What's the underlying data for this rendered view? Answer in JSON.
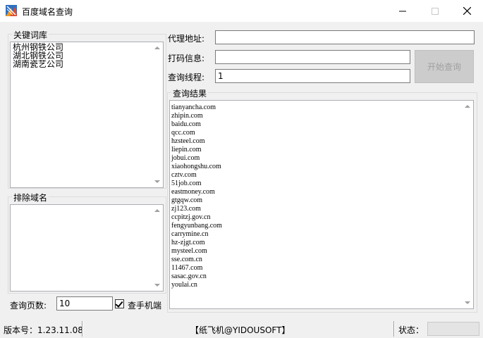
{
  "window": {
    "title": "百度域名查询",
    "minimize": "—",
    "maximize": "☐",
    "close": "✕"
  },
  "keywords": {
    "label": "关键词库",
    "items": [
      "杭州钢铁公司",
      "湖北钢铁公司",
      "湖南瓷艺公司"
    ]
  },
  "exclude": {
    "label": "排除域名",
    "items": []
  },
  "form": {
    "proxy_label": "代理地址:",
    "proxy_value": "",
    "captcha_label": "打码信息:",
    "captcha_value": "",
    "threads_label": "查询线程:",
    "threads_value": "1",
    "start_button": "开始查询",
    "pages_label": "查询页数:",
    "pages_value": "10",
    "mobile_label": "查手机端",
    "mobile_checked": true
  },
  "results": {
    "label": "查询结果",
    "items": [
      "tianyancha.com",
      "zhipin.com",
      "baidu.com",
      "qcc.com",
      "hzsteel.com",
      "liepin.com",
      "jobui.com",
      "xiaohongshu.com",
      "cztv.com",
      "51job.com",
      "eastmoney.com",
      "gtgqw.com",
      "zj123.com",
      "ccpitzj.gov.cn",
      "fengyunbang.com",
      "carrymine.cn",
      "hz-zjgt.com",
      "mysteel.com",
      "sse.com.cn",
      "11467.com",
      "sasac.gov.cn",
      "youlai.cn"
    ]
  },
  "statusbar": {
    "version": "版本号：1.23.11.08",
    "credit": "【纸飞机@YIDOUSOFT】",
    "status_label": "状态："
  }
}
